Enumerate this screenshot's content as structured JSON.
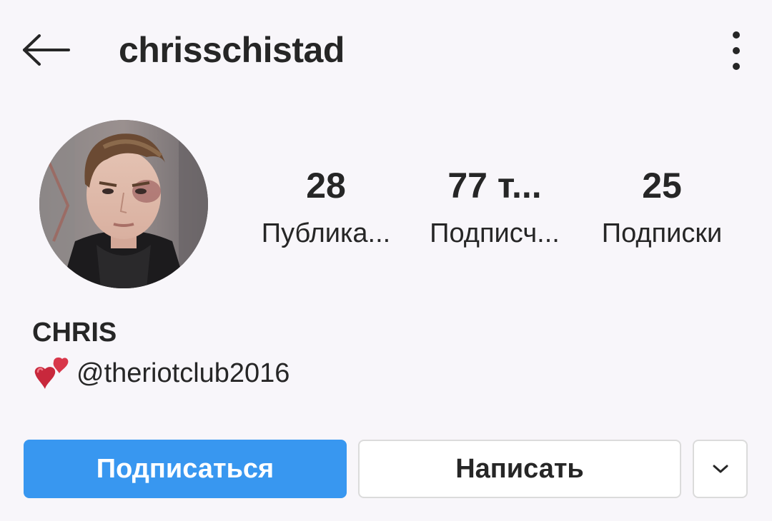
{
  "header": {
    "username": "chrisschistad",
    "back_icon": "arrow-left-icon",
    "more_icon": "more-vertical-icon"
  },
  "profile": {
    "avatar": "profile-photo",
    "stats": [
      {
        "value": "28",
        "label": "Публика..."
      },
      {
        "value": "77 т...",
        "label": "Подписч..."
      },
      {
        "value": "25",
        "label": "Подписки"
      }
    ],
    "name": "CHRIS",
    "bio_icon": "two-hearts-icon",
    "bio_text": "@theriotclub2016"
  },
  "actions": {
    "follow_label": "Подписаться",
    "message_label": "Написать",
    "dropdown_icon": "chevron-down-icon"
  },
  "colors": {
    "accent": "#3897f0",
    "background": "#f8f6fa",
    "text": "#262626",
    "border": "#dbdbdb"
  }
}
